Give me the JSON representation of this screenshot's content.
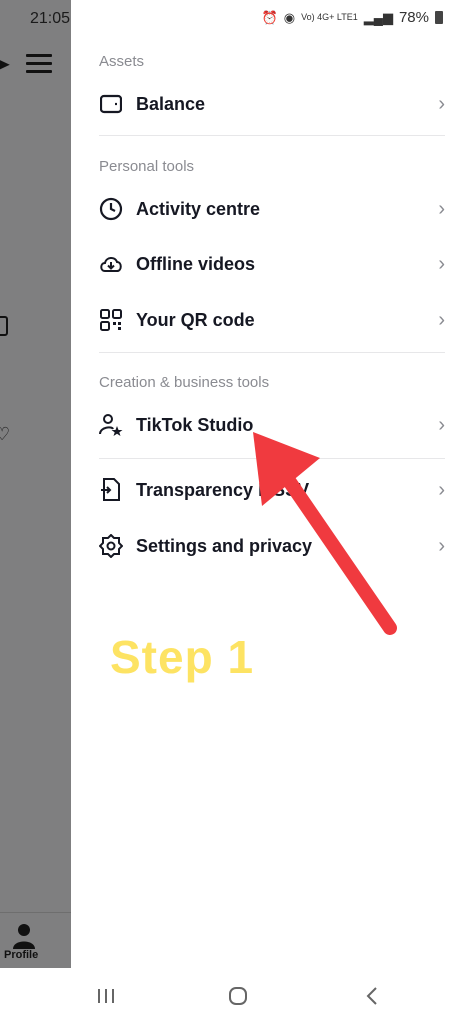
{
  "status_bar": {
    "time": "21:05",
    "network_labels": "Vo) 4G+ LTE1",
    "battery": "78%"
  },
  "background": {
    "profile_label": "Profile"
  },
  "sections": [
    {
      "title": "Assets",
      "items": [
        {
          "label": "Balance",
          "icon": "wallet-icon"
        }
      ]
    },
    {
      "title": "Personal tools",
      "items": [
        {
          "label": "Activity centre",
          "icon": "clock-icon"
        },
        {
          "label": "Offline videos",
          "icon": "download-cloud-icon"
        },
        {
          "label": "Your QR code",
          "icon": "qr-code-icon"
        }
      ]
    },
    {
      "title": "Creation & business tools",
      "items": [
        {
          "label": "TikTok Studio",
          "icon": "person-star-icon"
        }
      ]
    },
    {
      "title": "",
      "items": [
        {
          "label": "Transparency MSSV",
          "icon": "document-icon"
        },
        {
          "label": "Settings and privacy",
          "icon": "gear-icon"
        }
      ]
    }
  ],
  "annotation": {
    "step_label": "Step 1",
    "arrow_color": "#f03a3f",
    "step_color": "#fde363"
  },
  "nav_bar": {
    "recent": "recent-apps-icon",
    "home": "home-icon",
    "back": "back-icon"
  }
}
